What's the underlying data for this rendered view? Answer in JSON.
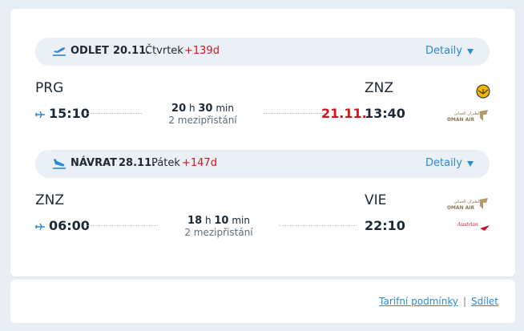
{
  "outbound": {
    "direction": "ODLET",
    "date": "20.11.",
    "weekday": "Čtvrtek",
    "day_diff": "+139d",
    "detail_label": "Detaily",
    "from_code": "PRG",
    "to_code": "ZNZ",
    "dep_time": "15:10",
    "arr_time": "13:40",
    "next_day": "21.11.",
    "duration_h": "20",
    "duration_m": "30",
    "h_unit": "h",
    "m_unit": "min",
    "stops": "2 mezipřistání",
    "carriers": [
      "lufthansa-logo",
      "oman-air-logo"
    ]
  },
  "inbound": {
    "direction": "NÁVRAT",
    "date": "28.11.",
    "weekday": "Pátek",
    "day_diff": "+147d",
    "detail_label": "Detaily",
    "from_code": "ZNZ",
    "to_code": "VIE",
    "dep_time": "06:00",
    "arr_time": "22:10",
    "duration_h": "18",
    "duration_m": "10",
    "h_unit": "h",
    "m_unit": "min",
    "stops": "2 mezipřistání",
    "carriers": [
      "oman-air-logo",
      "austrian-logo"
    ]
  },
  "logos": {
    "oman_arabic": "الطيران العماني",
    "oman_text": "OMAN AIR",
    "austrian_text": "Austrian"
  },
  "footer": {
    "fare_rules": "Tarifní podmínky",
    "separator": "|",
    "share": "Sdílet"
  },
  "colors": {
    "accent": "#2a8bd0",
    "red": "#d4141c",
    "header_bg": "#eaf0f5",
    "page_bg": "#e8eef3"
  }
}
